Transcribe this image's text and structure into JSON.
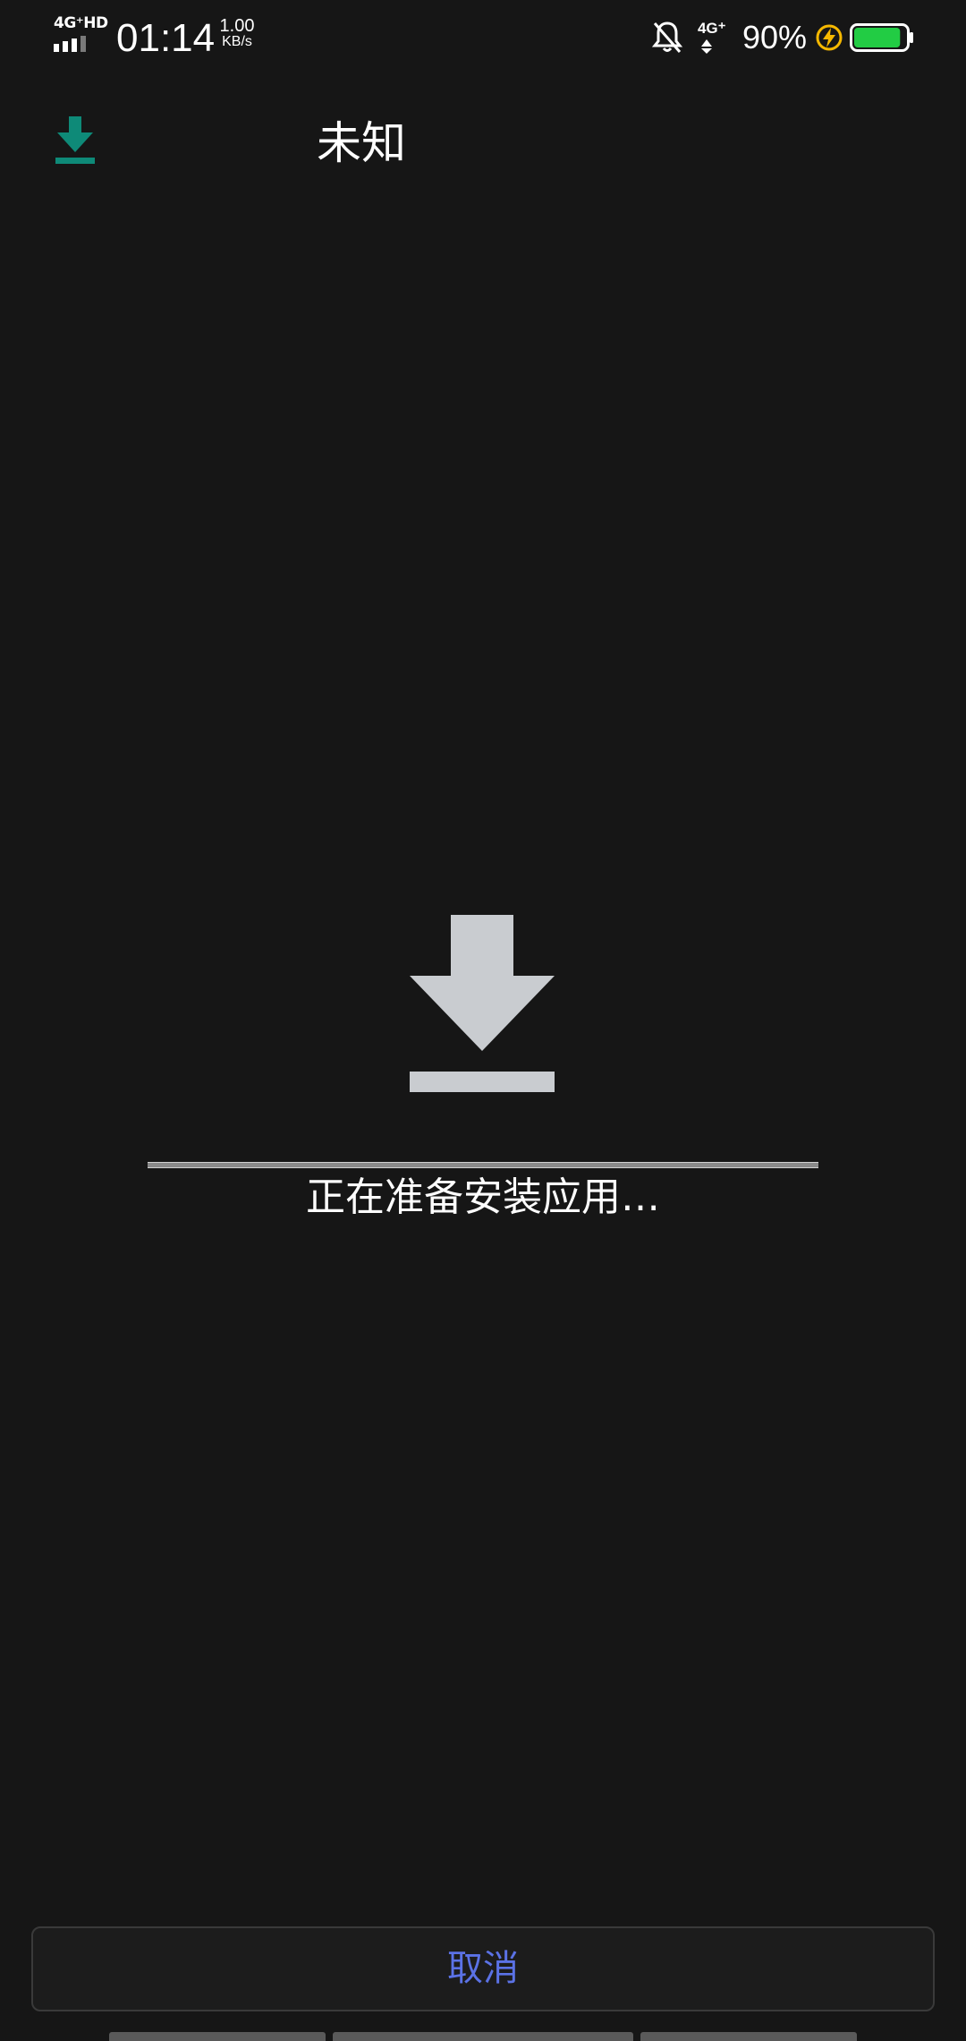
{
  "status_bar": {
    "network_label": "4G⁺HD",
    "time": "01:14",
    "speed_value": "1.00",
    "speed_unit": "KB/s",
    "mobile_label": "4G⁺",
    "battery_percent": "90%",
    "battery_level": 0.9,
    "icons": [
      "signal-bars-icon",
      "bell-off-icon",
      "mobile-data-icon",
      "charging-bolt-icon",
      "battery-icon"
    ]
  },
  "header": {
    "title": "未知",
    "icon": "download-icon",
    "icon_color": "#0e8a78"
  },
  "main": {
    "icon": "download-icon",
    "status_text": "正在准备安装应用…",
    "progress": 0.0
  },
  "footer": {
    "cancel_label": "取消",
    "cancel_color": "#5b72e6"
  },
  "colors": {
    "background": "#161616",
    "accent": "#5b72e6",
    "battery_green": "#22cc44",
    "bolt_yellow": "#f5b800"
  }
}
